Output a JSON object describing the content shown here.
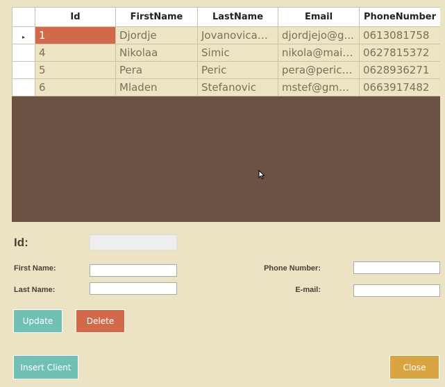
{
  "grid": {
    "columns": [
      "Id",
      "FirstName",
      "LastName",
      "Email",
      "PhoneNumber"
    ],
    "rows": [
      {
        "id": "1",
        "first": "Djordje",
        "last": "Jovanovicaaaa",
        "email": "djordjejo@g...",
        "phone": "0613081758"
      },
      {
        "id": "4",
        "first": "Nikolaa",
        "last": "Simic",
        "email": "nikola@mail....",
        "phone": "0627815372"
      },
      {
        "id": "5",
        "first": "Pera",
        "last": "Peric",
        "email": "pera@peric.c...",
        "phone": "0628936271"
      },
      {
        "id": "6",
        "first": "Mladen",
        "last": "Stefanovic",
        "email": "mstef@gmail....",
        "phone": "0663917482"
      }
    ],
    "selected_row_indicator": "▸",
    "selected_row": 0
  },
  "form": {
    "id_label": "Id:",
    "first_name_label": "First Name:",
    "last_name_label": "Last Name:",
    "phone_label": "Phone Number:",
    "email_label": "E-mail:",
    "id_value": "",
    "first_name_value": "",
    "last_name_value": "",
    "phone_value": "",
    "email_value": ""
  },
  "buttons": {
    "update": "Update",
    "delete": "Delete",
    "insert": "Insert Client",
    "close": "Close"
  },
  "colors": {
    "background": "#ECE3C4",
    "grid_empty": "#6B5343",
    "teal": "#70C1B3",
    "coral": "#D2694A",
    "gold": "#D9A441"
  }
}
